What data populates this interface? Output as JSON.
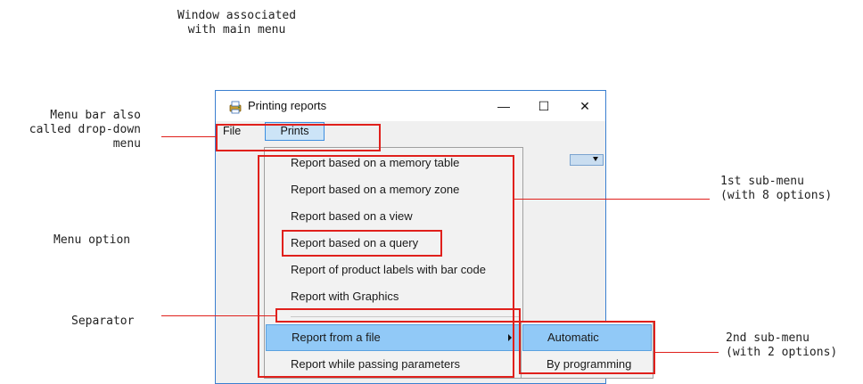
{
  "annotations": {
    "window_main_menu": "Window associated\nwith main menu",
    "menu_bar": "Menu bar also\ncalled drop-down\nmenu",
    "menu_option": "Menu option",
    "separator": "Separator",
    "first_submenu": "1st sub-menu\n(with 8 options)",
    "second_submenu": "2nd sub-menu\n(with 2 options)"
  },
  "window": {
    "title": "Printing reports",
    "minimize_glyph": "—",
    "maximize_glyph": "☐",
    "close_glyph": "✕",
    "icon": "printer-app-icon"
  },
  "menubar": {
    "file_label": "File",
    "prints_label": "Prints"
  },
  "dropdown": {
    "items": [
      "Report based on a memory table",
      "Report based on a memory zone",
      "Report based on a view",
      "Report based on a query",
      "Report of product labels with bar code",
      "Report with Graphics",
      "Report from a file",
      "Report while passing parameters"
    ]
  },
  "submenu": {
    "items": [
      "Automatic",
      "By programming"
    ]
  },
  "colors": {
    "annotation_red": "#e0201c",
    "highlight": "#91c9f7",
    "window_border": "#3a7fd0"
  }
}
